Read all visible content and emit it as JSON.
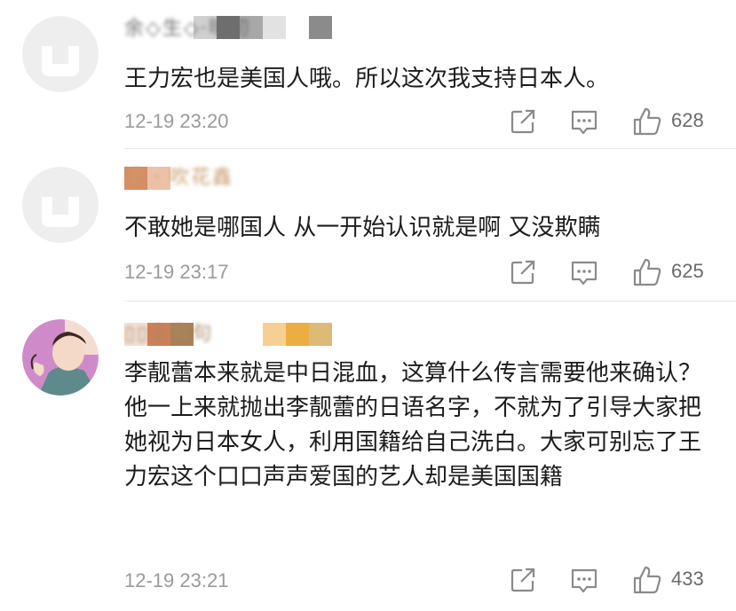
{
  "comments": [
    {
      "username": "余◇生◇·明初",
      "avatar": "default-avatar",
      "content": "王力宏也是美国人哦。所以这次我支持日本人。",
      "timestamp": "12-19 23:20",
      "likes": "628",
      "mosaic_colors": [
        "#ffffff",
        "#ffffff",
        "#ffffff",
        "#c8c8c8",
        "#555555",
        "#9a9a9a",
        "#dddddd",
        "#ffffff",
        "#777777"
      ]
    },
    {
      "username": "凌 · 吹花鑫",
      "avatar": "default-avatar",
      "content": "不敢她是哪国人 从一开始认识就是啊 又没欺瞒",
      "timestamp": "12-19 23:17",
      "likes": "625",
      "mosaic_colors": [
        "#d27a4a",
        "#e8b89a",
        "#ffffff",
        "#ffffff",
        "#ffffff"
      ]
    },
    {
      "username": "▯▯上有句",
      "avatar": "cartoon-avatar",
      "content": "李靓蕾本来就是中日混血，这算什么传言需要他来确认？他一上来就抛出李靓蕾的日语名字，不就为了引导大家把她视为日本女人，利用国籍给自己洗白。大家可别忘了王力宏这个口口声声爱国的艺人却是美国国籍",
      "timestamp": "12-19 23:21",
      "likes": "433",
      "mosaic_colors": [
        "#f3ddd0",
        "#c46a3a",
        "#9a6a3a",
        "#ffffff",
        "#ffffff",
        "#ffffff",
        "#f5c880",
        "#e8a020",
        "#d8b060"
      ]
    }
  ]
}
